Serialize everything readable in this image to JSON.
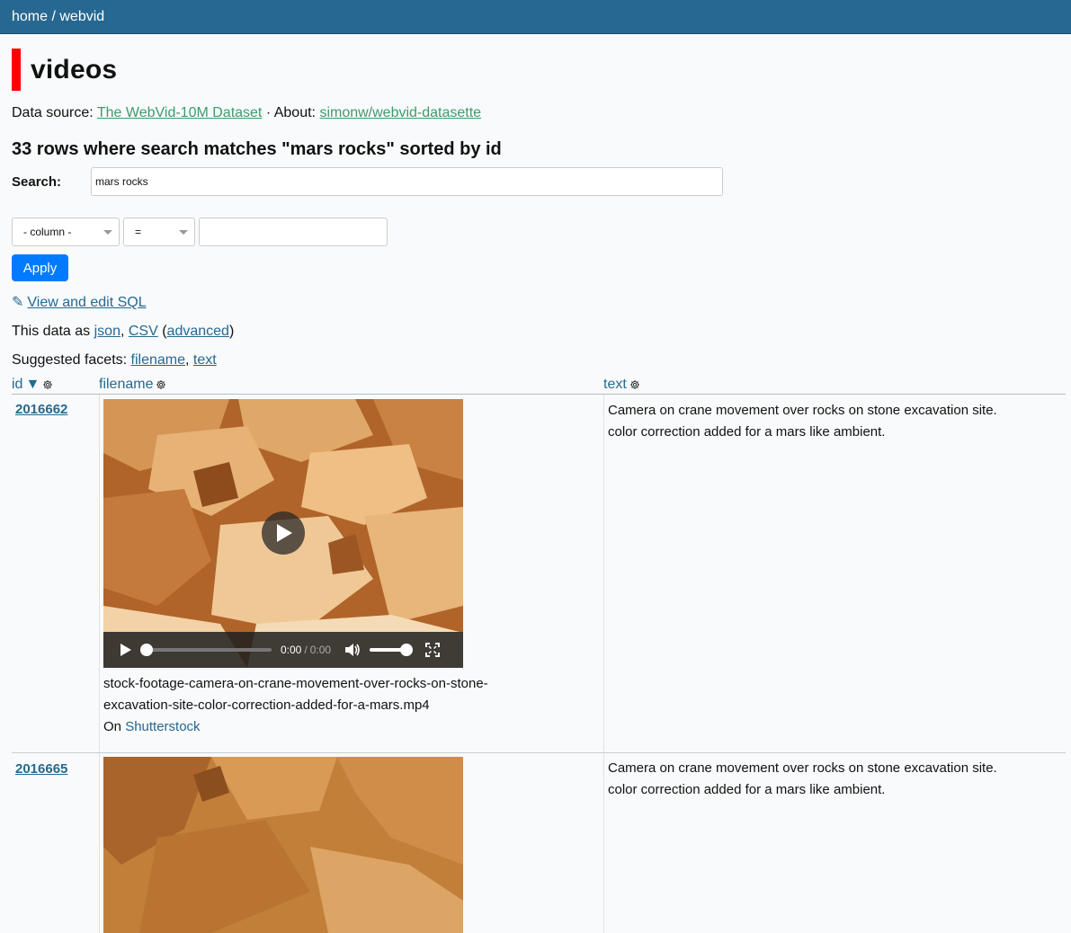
{
  "breadcrumb": "home / webvid",
  "title": "videos",
  "source": {
    "data_source_label": "Data source:",
    "data_source_link": "The WebVid-10M Dataset",
    "separator": "·",
    "about_label": "About:",
    "about_link": "simonw/webvid-datasette"
  },
  "summary": "33 rows where search matches \"mars rocks\" sorted by id",
  "search": {
    "label": "Search:",
    "value": "mars rocks"
  },
  "filter": {
    "column": "- column -",
    "operator": "=",
    "value": ""
  },
  "apply_label": "Apply",
  "sql_link": "View and edit SQL",
  "export": {
    "prefix": "This data as",
    "json": "json",
    "csv": "CSV",
    "advanced": "advanced"
  },
  "facets": {
    "prefix": "Suggested facets:",
    "items": [
      "filename",
      "text"
    ]
  },
  "columns": {
    "id": "id",
    "sort_indicator": "▼",
    "filename": "filename",
    "text": "text"
  },
  "rows": [
    {
      "id": "2016662",
      "filename_line1": "stock-footage-camera-on-crane-movement-over-rocks-on-stone-",
      "filename_line2": "excavation-site-color-correction-added-for-a-mars.mp4",
      "on_label": "On",
      "on_link": "Shutterstock",
      "text_line1": "Camera on crane movement over rocks on stone excavation site.",
      "text_line2": "color correction added for a mars like ambient.",
      "player": {
        "time_current": "0:00",
        "time_sep": "/",
        "time_total": "0:00"
      }
    },
    {
      "id": "2016665",
      "text_line1": "Camera on crane movement over rocks on stone excavation site.",
      "text_line2": "color correction added for a mars like ambient."
    }
  ],
  "colors": {
    "header": "#276890",
    "title_bar": "#ff0000",
    "apply": "#007bff",
    "source_link": "#3b9c6b"
  }
}
